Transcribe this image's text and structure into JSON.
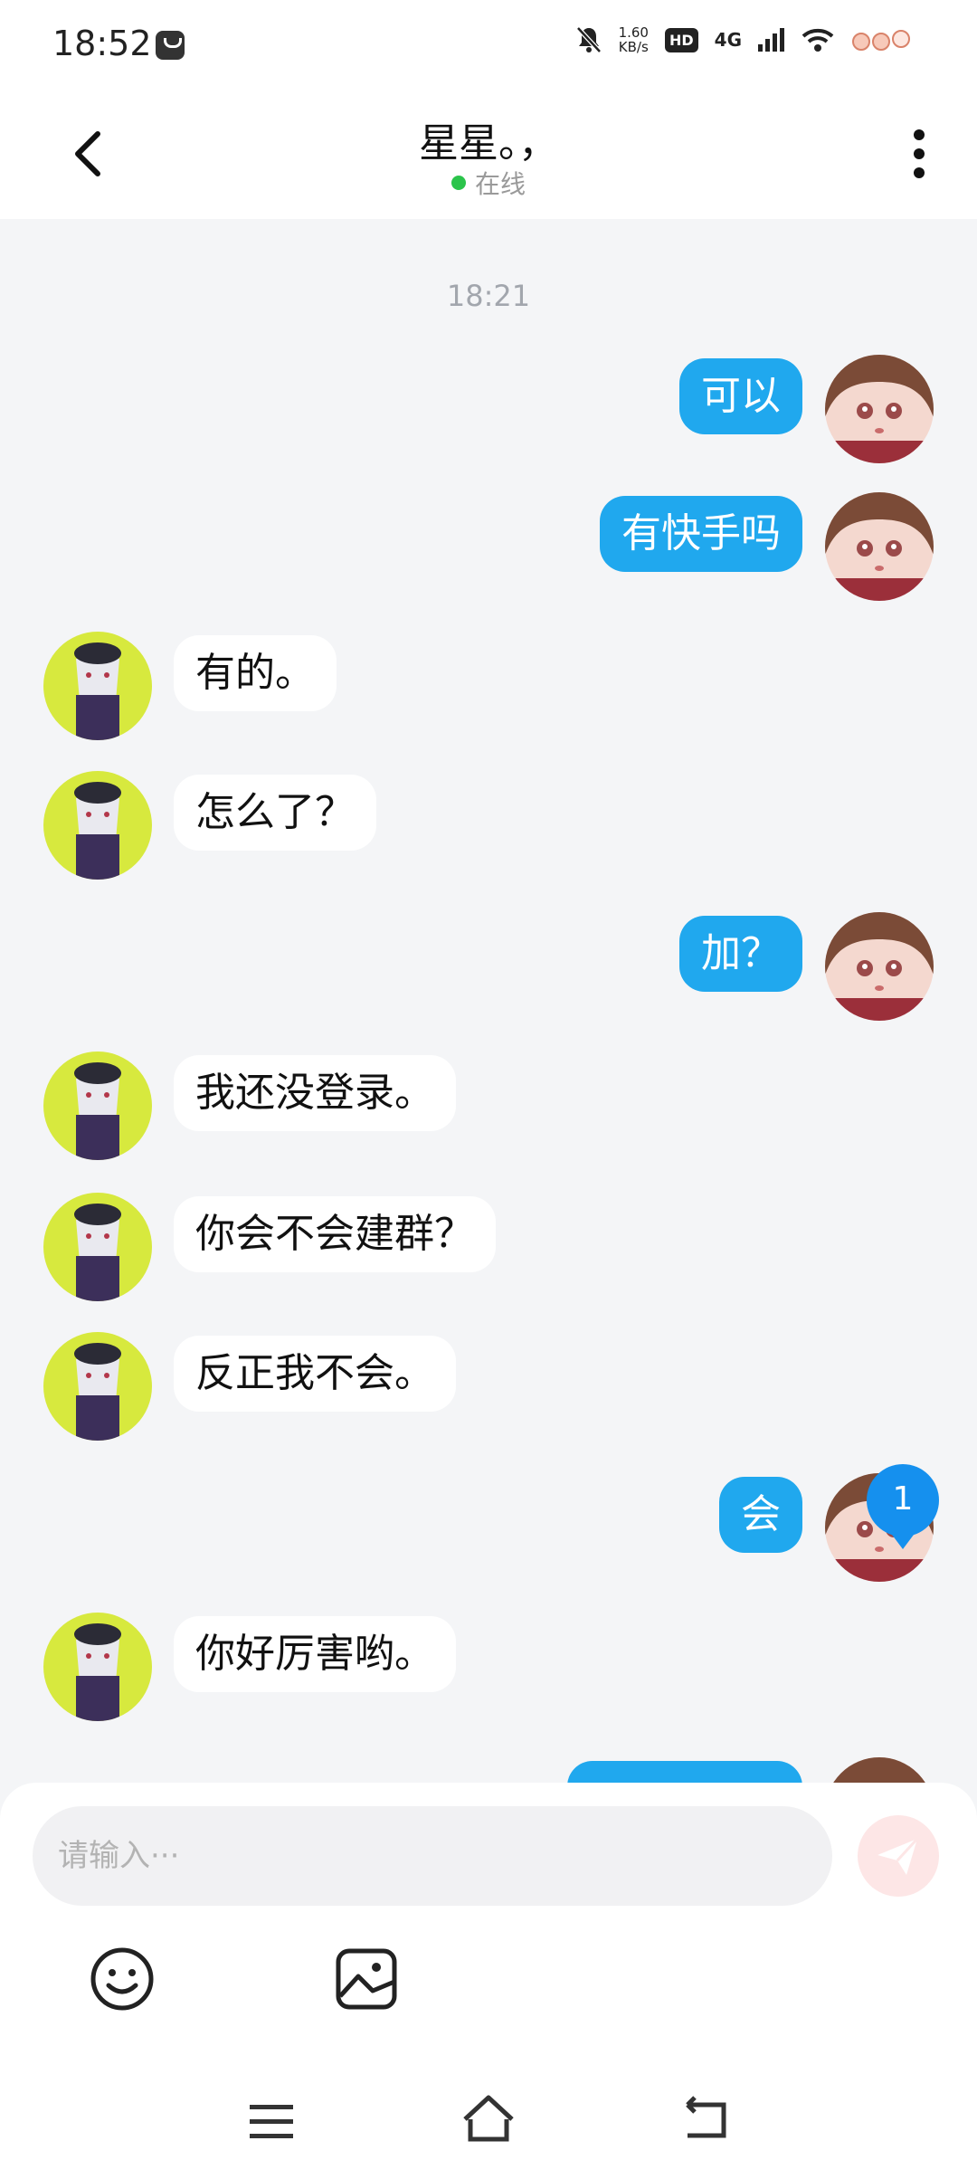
{
  "status_bar": {
    "time": "18:52",
    "net_speed_value": "1.60",
    "net_speed_unit": "KB/s",
    "hd": "HD",
    "network": "4G"
  },
  "header": {
    "title": "星星。，",
    "status": "在线"
  },
  "timestamp": "18:21",
  "messages": [
    {
      "from": "me",
      "text": "可以"
    },
    {
      "from": "me",
      "text": "有快手吗"
    },
    {
      "from": "peer",
      "text": "有的。"
    },
    {
      "from": "peer",
      "text": "怎么了？"
    },
    {
      "from": "me",
      "text": "加？"
    },
    {
      "from": "peer",
      "text": "我还没登录。"
    },
    {
      "from": "peer",
      "text": "你会不会建群？"
    },
    {
      "from": "peer",
      "text": "反正我不会。"
    },
    {
      "from": "me",
      "text": "会"
    },
    {
      "from": "peer",
      "text": "你好厉害哟。"
    }
  ],
  "unread_count": "1",
  "input": {
    "placeholder": "请输入···",
    "value": ""
  },
  "colors": {
    "accent": "#20a8ee",
    "online": "#2bc44b",
    "badge": "#1590ee",
    "send_disabled": "#fde6e6"
  },
  "icons": [
    "back-arrow-icon",
    "more-vertical-icon",
    "send-icon",
    "emoji-icon",
    "image-icon",
    "menu-icon",
    "home-icon",
    "return-icon"
  ]
}
